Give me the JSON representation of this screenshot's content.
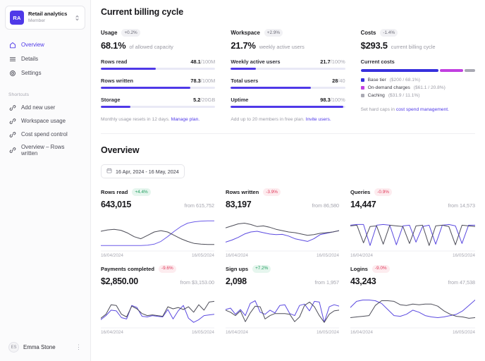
{
  "sidebar": {
    "workspace": {
      "initials": "RA",
      "name": "Retail analytics",
      "role": "Member"
    },
    "nav": [
      {
        "label": "Overview",
        "icon": "home-icon"
      },
      {
        "label": "Details",
        "icon": "list-icon"
      },
      {
        "label": "Settings",
        "icon": "gear-icon"
      }
    ],
    "shortcuts_label": "Shortcuts",
    "shortcuts": [
      {
        "label": "Add new user"
      },
      {
        "label": "Workspace usage"
      },
      {
        "label": "Cost spend control"
      },
      {
        "label": "Overview – Rows written"
      }
    ],
    "user": {
      "initials": "ES",
      "name": "Emma Stone",
      "menu_icon": "kebab-menu-icon"
    }
  },
  "billing": {
    "title": "Current billing cycle",
    "usage": {
      "label": "Usage",
      "badge": "+0.2%",
      "badge_tone": "neutral",
      "big_value": "68.1%",
      "big_sub": "of allowed capacity",
      "metrics": [
        {
          "name": "Rows read",
          "value": "48.1",
          "denominator": "/100M",
          "pct": 48.1
        },
        {
          "name": "Rows written",
          "value": "78.3",
          "denominator": "/100M",
          "pct": 78.3
        },
        {
          "name": "Storage",
          "value": "5.2",
          "denominator": "/20GB",
          "pct": 26
        }
      ],
      "footer_text": "Monthly usage resets in 12 days. ",
      "footer_link": "Manage plan."
    },
    "workspace": {
      "label": "Workspace",
      "badge": "+2.9%",
      "badge_tone": "neutral",
      "big_value": "21.7%",
      "big_sub": "weekly active users",
      "metrics": [
        {
          "name": "Weekly active users",
          "value": "21.7",
          "denominator": "/100%",
          "pct": 21.7
        },
        {
          "name": "Total users",
          "value": "28",
          "denominator": "/40",
          "pct": 70
        },
        {
          "name": "Uptime",
          "value": "98.3",
          "denominator": "/100%",
          "pct": 98.3
        }
      ],
      "footer_text": "Add up to 20 members in free plan. ",
      "footer_link": "Invite users."
    },
    "costs": {
      "label": "Costs",
      "badge": "-1.4%",
      "badge_tone": "neutral",
      "big_value": "$293.5",
      "big_sub": "current billing cycle",
      "section_title": "Current costs",
      "segments": [
        {
          "label": "Base tier",
          "value": "($200 / 68.1%)",
          "pct": 68.1,
          "color": "#3730dd"
        },
        {
          "label": "On-demand charges",
          "value": "($61.1 / 20.8%)",
          "pct": 20.8,
          "color": "#c13fe0"
        },
        {
          "label": "Caching",
          "value": "($31.9 / 11.1%)",
          "pct": 11.1,
          "color": "#a9a9b3"
        }
      ],
      "footer_text": "Set hard caps in ",
      "footer_link": "cost spend management."
    }
  },
  "overview": {
    "title": "Overview",
    "date_range": "16 Apr, 2024 - 16 May, 2024",
    "date_icon": "calendar-icon",
    "cards": [
      {
        "title": "Rows read",
        "badge": "+4.4%",
        "badge_tone": "pos",
        "value": "643,015",
        "from": "from 615,752",
        "date_start": "16/04/2024",
        "date_end": "16/05/2024",
        "chart_data": {
          "type": "line",
          "title": "Rows read",
          "x": [
            "16/04/2024",
            "16/05/2024"
          ],
          "series": [
            {
              "name": "current",
              "color": "#6c5ce8",
              "values": [
                10,
                10,
                10,
                10,
                10,
                10,
                10,
                11,
                14,
                22,
                36,
                52,
                66,
                76,
                80,
                82,
                83,
                83
              ]
            },
            {
              "name": "previous",
              "color": "#4d4d58",
              "values": [
                52,
                56,
                58,
                55,
                47,
                36,
                30,
                40,
                50,
                54,
                50,
                40,
                30,
                22,
                16,
                14,
                13,
                13
              ]
            }
          ]
        }
      },
      {
        "title": "Rows written",
        "badge": "-3.9%",
        "badge_tone": "neg",
        "value": "83,197",
        "from": "from 86,580",
        "date_start": "16/04/2024",
        "date_end": "16/05/2024",
        "chart_data": {
          "type": "line",
          "title": "Rows written",
          "x": [
            "16/04/2024",
            "16/05/2024"
          ],
          "series": [
            {
              "name": "current",
              "color": "#5b4ae0",
              "values": [
                20,
                26,
                34,
                44,
                50,
                52,
                48,
                44,
                42,
                43,
                38,
                30,
                26,
                22,
                30,
                42,
                46,
                50,
                54
              ]
            },
            {
              "name": "previous",
              "color": "#4d4d58",
              "values": [
                62,
                68,
                74,
                76,
                72,
                66,
                68,
                64,
                58,
                54,
                50,
                48,
                44,
                40,
                42,
                46,
                48,
                50,
                54
              ]
            }
          ]
        }
      },
      {
        "title": "Queries",
        "badge": "-0.9%",
        "badge_tone": "neg",
        "value": "14,447",
        "from": "from 14,573",
        "date_start": "16/04/2024",
        "date_end": "16/05/2024",
        "chart_data": {
          "type": "line",
          "title": "Queries",
          "x": [
            "16/04/2024",
            "16/05/2024"
          ],
          "series": [
            {
              "name": "current",
              "color": "#5b4ae0",
              "values": [
                70,
                72,
                72,
                10,
                70,
                72,
                70,
                12,
                68,
                70,
                20,
                66,
                70,
                14,
                70,
                72,
                68,
                16,
                70,
                70
              ]
            },
            {
              "name": "previous",
              "color": "#4d4d58",
              "values": [
                68,
                70,
                18,
                66,
                68,
                14,
                70,
                68,
                66,
                16,
                68,
                70,
                10,
                68,
                70,
                66,
                12,
                70,
                68,
                66
              ]
            }
          ]
        }
      },
      {
        "title": "Payments completed",
        "badge": "-9.6%",
        "badge_tone": "neg",
        "value": "$2,850.00",
        "from": "from $3,153.00",
        "date_start": "16/04/2024",
        "date_end": "16/05/2024",
        "chart_data": {
          "type": "line",
          "title": "Payments completed",
          "x": [
            "16/04/2024",
            "16/05/2024"
          ],
          "series": [
            {
              "name": "current",
              "color": "#5b4ae0",
              "values": [
                18,
                30,
                46,
                44,
                24,
                20,
                60,
                54,
                28,
                26,
                30,
                28,
                26,
                48,
                20,
                44,
                60,
                22,
                10,
                18,
                30,
                32,
                34
              ]
            },
            {
              "name": "previous",
              "color": "#4d4d58",
              "values": [
                22,
                34,
                62,
                60,
                34,
                26,
                58,
                50,
                36,
                30,
                32,
                30,
                28,
                56,
                50,
                54,
                48,
                56,
                40,
                62,
                46,
                70,
                72
              ]
            }
          ]
        }
      },
      {
        "title": "Sign ups",
        "badge": "+7.2%",
        "badge_tone": "pos",
        "value": "2,098",
        "from": "from 1,957",
        "date_start": "16/04/2024",
        "date_end": "16/05/2024",
        "chart_data": {
          "type": "line",
          "title": "Sign ups",
          "x": [
            "16/04/2024",
            "16/05/2024"
          ],
          "series": [
            {
              "name": "current",
              "color": "#5b4ae0",
              "values": [
                48,
                52,
                34,
                48,
                30,
                66,
                74,
                40,
                34,
                46,
                38,
                60,
                62,
                36,
                30,
                60,
                64,
                44,
                72,
                70,
                10,
                56,
                62,
                58
              ]
            },
            {
              "name": "previous",
              "color": "#4d4d58",
              "values": [
                46,
                40,
                30,
                44,
                12,
                38,
                58,
                56,
                20,
                30,
                36,
                36,
                36,
                34,
                12,
                26,
                60,
                70,
                56,
                30,
                10,
                34,
                44,
                46
              ]
            }
          ]
        }
      },
      {
        "title": "Logins",
        "badge": "-9.0%",
        "badge_tone": "neg",
        "value": "43,243",
        "from": "from 47,538",
        "date_start": "16/04/2024",
        "date_end": "16/05/2024",
        "chart_data": {
          "type": "line",
          "title": "Logins",
          "x": [
            "16/04/2024",
            "16/05/2024"
          ],
          "series": [
            {
              "name": "current",
              "color": "#5b4ae0",
              "values": [
                54,
                72,
                76,
                76,
                74,
                66,
                48,
                30,
                28,
                34,
                46,
                40,
                30,
                26,
                24,
                26,
                30,
                34,
                44,
                60,
                76
              ]
            },
            {
              "name": "previous",
              "color": "#4d4d58",
              "values": [
                24,
                26,
                28,
                30,
                60,
                74,
                74,
                72,
                62,
                60,
                64,
                62,
                64,
                64,
                58,
                44,
                34,
                28,
                26,
                22,
                24
              ]
            }
          ]
        }
      }
    ]
  }
}
